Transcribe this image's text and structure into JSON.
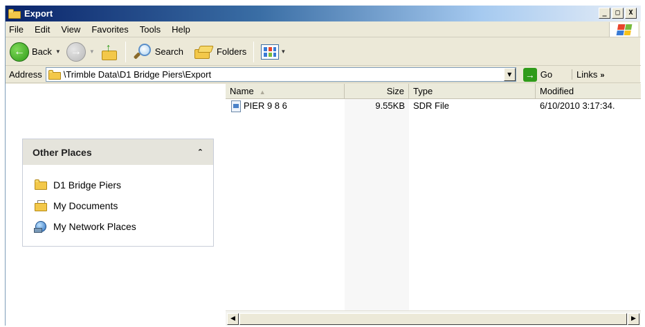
{
  "window": {
    "title": "Export"
  },
  "window_controls": {
    "minimize": "_",
    "maximize": "□",
    "close": "X"
  },
  "menu": [
    "File",
    "Edit",
    "View",
    "Favorites",
    "Tools",
    "Help"
  ],
  "toolbar": {
    "back_label": "Back",
    "search_label": "Search",
    "folders_label": "Folders"
  },
  "address": {
    "label": "Address",
    "path": "\\Trimble Data\\D1 Bridge Piers\\Export",
    "go_label": "Go",
    "links_label": "Links"
  },
  "other_places": {
    "title": "Other Places",
    "items": [
      "D1 Bridge Piers",
      "My Documents",
      "My Network Places"
    ]
  },
  "columns": {
    "name": "Name",
    "size": "Size",
    "type": "Type",
    "modified": "Modified"
  },
  "files": [
    {
      "name": "PIER 9 8 6",
      "size": "9.55KB",
      "type": "SDR File",
      "modified": "6/10/2010 3:17:34."
    }
  ],
  "icons": {
    "title": "folder-icon",
    "back": "back-arrow-icon",
    "forward": "forward-arrow-icon",
    "up": "folder-up-icon",
    "search": "magnifier-icon",
    "folders": "folders-icon",
    "views": "views-icon",
    "go": "go-arrow-icon"
  },
  "colors": {
    "titlebar_start": "#0a246a",
    "titlebar_end": "#e8eef7",
    "chrome": "#ece9d8"
  }
}
